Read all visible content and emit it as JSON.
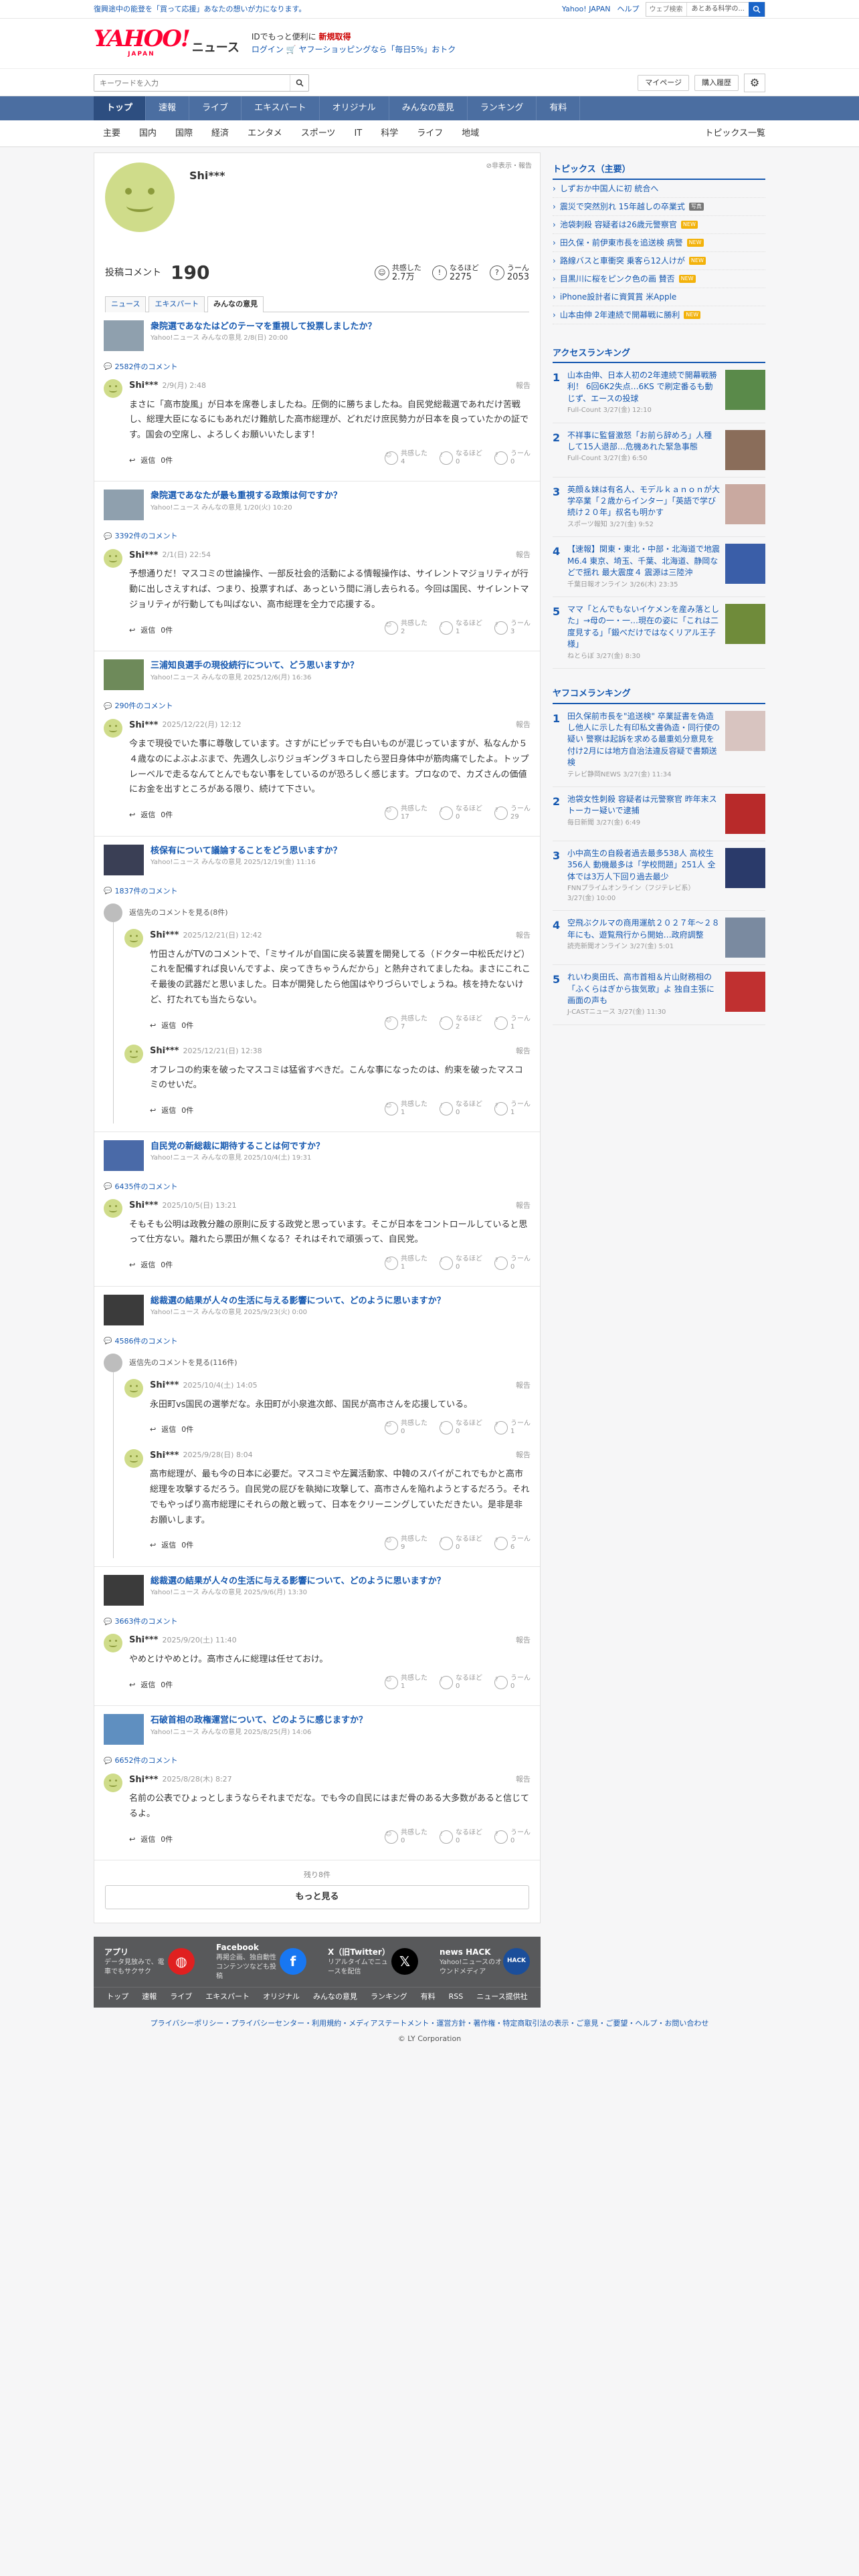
{
  "topbar": {
    "notice": "復興途中の能登を「買って応援」あなたの想いが力になります。",
    "links": [
      "Yahoo! JAPAN",
      "ヘルプ"
    ],
    "search_placeholder": "ウェブ検索",
    "search_scope": "あとある科学の..."
  },
  "header": {
    "logo": "YAHOO!",
    "logo_sub": "JAPAN",
    "section": "ニュース",
    "promo_line1_a": "ID",
    "promo_line1_b": "でもっと便利に",
    "promo_line1_c": "新規取得",
    "promo_line2_a": "ログイン",
    "promo_line2_b": "ヤフーショッピングなら「毎日5%」おトク"
  },
  "search": {
    "placeholder": "キーワードを入力",
    "mypage": "マイページ",
    "history": "購入履歴"
  },
  "gnav": [
    "トップ",
    "速報",
    "ライブ",
    "エキスパート",
    "オリジナル",
    "みんなの意見",
    "ランキング",
    "有料"
  ],
  "snav": [
    "主要",
    "国内",
    "国際",
    "経済",
    "エンタメ",
    "スポーツ",
    "IT",
    "科学",
    "ライフ",
    "地域"
  ],
  "snav_right": "トピックス一覧",
  "profile": {
    "name": "Shi***",
    "report": "非表示・報告",
    "posts_label": "投稿コメント",
    "posts": "190",
    "reactions": [
      {
        "label": "共感した",
        "value": "2.7万",
        "icon": "☺"
      },
      {
        "label": "なるほど",
        "value": "2275",
        "icon": "!"
      },
      {
        "label": "うーん",
        "value": "2053",
        "icon": "?"
      }
    ]
  },
  "tabs": [
    "ニュース",
    "エキスパート",
    "みんなの意見"
  ],
  "blocks": [
    {
      "title": "衆院選であなたはどのテーマを重視して投票しましたか？",
      "meta": "Yahoo!ニュース みんなの意見 2/8(日) 20:00",
      "count": "2582件のコメント",
      "comments": [
        {
          "name": "Shi***",
          "date": "2/9(月) 2:48",
          "text": "まさに「高市旋風」が日本を席巻しましたね。圧倒的に勝ちましたね。自民党総裁選であれだけ苦戦し、総理大臣になるにもあれだけ難航した高市総理が、どれだけ庶民勢力が日本を良っていたかの証です。国会の空席し、よろしくお願いいたします！",
          "r": [
            "4",
            "0",
            "0"
          ]
        }
      ]
    },
    {
      "title": "衆院選であなたが最も重視する政策は何ですか？",
      "meta": "Yahoo!ニュース みんなの意見 1/20(火) 10:20",
      "count": "3392件のコメント",
      "comments": [
        {
          "name": "Shi***",
          "date": "2/1(日) 22:54",
          "text": "予想通りだ！マスコミの世論操作、一部反社会的活動による情報操作は、サイレントマジョリティが行動に出しさえすれば、つまり、投票すれば、あっという間に消し去られる。今回は国民、サイレントマジョリティが行動しても叫ばない、高市総理を全力で応援する。",
          "r": [
            "2",
            "1",
            "3"
          ]
        }
      ]
    },
    {
      "title": "三浦知良選手の現役続行について、どう思いますか？",
      "meta": "Yahoo!ニュース みんなの意見 2025/12/6(月) 16:36",
      "count": "290件のコメント",
      "comments": [
        {
          "name": "Shi***",
          "date": "2025/12/22(月) 12:12",
          "text": "今まで現役でいた事に尊敬しています。さすがにピッチでも白いものが混じっていますが、私なんか５４歳なのによぶよぶまで、先週久しぶりジョギング３キロしたら翌日身体中が筋肉痛でしたよ。トップレーベルで走るなんてとんでもない事をしているのが恐ろしく感じます。プロなので、カズさんの価値にお金を出すところがある限り、続けて下さい。",
          "r": [
            "17",
            "0",
            "29"
          ]
        }
      ]
    },
    {
      "title": "核保有について議論することをどう思いますか？",
      "meta": "Yahoo!ニュース みんなの意見 2025/12/19(金) 11:16",
      "count": "1837件のコメント",
      "collapsed": "返信先のコメントを見る(8件)",
      "comments": [
        {
          "name": "Shi***",
          "date": "2025/12/21(日) 12:42",
          "text": "竹田さんがTVのコメントで、「ミサイルが自国に戻る装置を開発してる（ドクター中松氏だけど）これを配備すれば良いんですよ、戻ってきちゃうんだから」と熱弁されてましたね。まさにこれこそ最後の武器だと思いました。日本が開発したら他国はやりづらいでしょうね。核を持たないけど、打たれても当たらない。",
          "r": [
            "7",
            "2",
            "1"
          ]
        },
        {
          "name": "Shi***",
          "date": "2025/12/21(日) 12:38",
          "text": "オフレコの約束を破ったマスコミは猛省すべきだ。こんな事になったのは、約束を破ったマスコミのせいだ。",
          "r": [
            "1",
            "0",
            "1"
          ]
        }
      ]
    },
    {
      "title": "自民党の新総裁に期待することは何ですか？",
      "meta": "Yahoo!ニュース みんなの意見 2025/10/4(土) 19:31",
      "count": "6435件のコメント",
      "comments": [
        {
          "name": "Shi***",
          "date": "2025/10/5(日) 13:21",
          "text": "そもそも公明は政教分離の原則に反する政党と思っています。そこが日本をコントロールしていると思って仕方ない。離れたら票田が無くなる？それはそれで頑張って、自民党。",
          "r": [
            "1",
            "0",
            "0"
          ]
        }
      ]
    },
    {
      "title": "総裁選の結果が人々の生活に与える影響について、どのように思いますか？",
      "meta": "Yahoo!ニュース みんなの意見 2025/9/23(火) 0:00",
      "count": "4586件のコメント",
      "collapsed": "返信先のコメントを見る(116件)",
      "comments": [
        {
          "name": "Shi***",
          "date": "2025/10/4(土) 14:05",
          "text": "永田町vs国民の選挙だな。永田町が小泉進次郎、国民が高市さんを応援している。",
          "r": [
            "0",
            "0",
            "1"
          ]
        },
        {
          "name": "Shi***",
          "date": "2025/9/28(日) 8:04",
          "text": "高市総理が、最も今の日本に必要だ。マスコミや左翼活動家、中韓のスパイがこれでもかと高市総理を攻撃するだろう。自民党の屁びを執拗に攻撃して、高市さんを陥れようとするだろう。それでもやっぱり高市総理にそれらの敵と戦って、日本をクリーニングしていただきたい。是非是非お願いします。",
          "r": [
            "9",
            "0",
            "6"
          ]
        }
      ]
    },
    {
      "title": "総裁選の結果が人々の生活に与える影響について、どのように思いますか？",
      "meta": "Yahoo!ニュース みんなの意見 2025/9/6(月) 13:30",
      "count": "3663件のコメント",
      "comments": [
        {
          "name": "Shi***",
          "date": "2025/9/20(土) 11:40",
          "text": "やめとけやめとけ。高市さんに総理は任せておけ。",
          "r": [
            "1",
            "0",
            "0"
          ]
        }
      ]
    },
    {
      "title": "石破首相の政権運営について、どのように感じますか？",
      "meta": "Yahoo!ニュース みんなの意見 2025/8/25(月) 14:06",
      "count": "6652件のコメント",
      "comments": [
        {
          "name": "Shi***",
          "date": "2025/8/28(木) 8:27",
          "text": "名前の公表でひょっとしまうならそれまでだな。でも今の自民にはまだ骨のある大多数があると信じてるよ。",
          "r": [
            "0",
            "0",
            "0"
          ]
        }
      ]
    }
  ],
  "reply_label": "返信",
  "reply_count": "0件",
  "report_label": "報告",
  "react_labels": [
    "共感した",
    "なるほど",
    "うーん"
  ],
  "more": {
    "remaining": "残り8件",
    "button": "もっと見る"
  },
  "sidebar": {
    "topics_title": "トピックス（主要）",
    "topics": [
      {
        "t": "しずおか中国人に初 統合へ",
        "b": ""
      },
      {
        "t": "震災で突然別れ 15年越しの卒業式",
        "b": "写真"
      },
      {
        "t": "池袋刺殺 容疑者は26歳元警察官",
        "b": "NEW"
      },
      {
        "t": "田久保・前伊東市長を追送検 病警",
        "b": "NEW"
      },
      {
        "t": "路線バスと車衝突 乗客ら12人けが",
        "b": "NEW"
      },
      {
        "t": "目黒川に桜をピンク色の画 賛否",
        "b": "NEW"
      },
      {
        "t": "iPhone設計者に資質賞 米Apple",
        "b": ""
      },
      {
        "t": "山本由伸 2年連続で開幕戦に勝利",
        "b": "NEW"
      }
    ],
    "access_title": "アクセスランキング",
    "access": [
      {
        "t": "山本由伸、日本人初の2年連続で開幕戦勝利！ 6回6K2失点…6KS で刷定番るも動じず、エースの投球",
        "m": "Full-Count 3/27(金) 12:10",
        "c": "#5a8a4a"
      },
      {
        "t": "不祥事に監督激怒「お前ら辞めろ」人種して15人退部…危機あれた緊急事態",
        "m": "Full-Count 3/27(金) 6:50",
        "c": "#8a6d5a"
      },
      {
        "t": "英顔＆妹は有名人、モデルｋａｎｏｎが大学卒業「２歳からインター」「英語で学び続け２０年」叔名も明かす",
        "m": "スポーツ報知 3/27(金) 9:52",
        "c": "#c9a9a0"
      },
      {
        "t": "【速報】関東・東北・中部・北海道で地震 M6.4 東京、埼玉、千葉、北海道、静岡などで揺れ 最大震度４ 震源は三陸沖",
        "m": "千葉日報オンライン 3/26(木) 23:35",
        "c": "#3a5ea8"
      },
      {
        "t": "ママ「とんでもないイケメンを産み落とした」→母の一・一…現在の姿に「これは二度見する」「鍛べだけではなくリアル王子様」",
        "m": "ねとらぼ 3/27(金) 8:30",
        "c": "#6f8b3a"
      }
    ],
    "comment_title": "ヤフコメランキング",
    "comments": [
      {
        "t": "田久保前市長を\"追送検\" 卒業証書を偽造し他人に示した有印私文書偽造・同行使の疑い 警察は起訴を求める最重処分意見を付け2月には地方自治法違反容疑で書類送検",
        "m": "テレビ静岡NEWS 3/27(金) 11:34",
        "c": "#d8c4c0"
      },
      {
        "t": "池袋女性刺殺 容疑者は元警察官 昨年末ストーカー疑いで逮捕",
        "m": "毎日新聞 3/27(金) 6:49",
        "c": "#b82a2a"
      },
      {
        "t": "小中高生の自殺者過去最多538人 高校生356人 動機最多は「学校問題」251人 全体では3万人下回り過去最少",
        "m": "FNNプライムオンライン（フジテレビ系） 3/27(金) 10:00",
        "c": "#2a3a6a"
      },
      {
        "t": "空飛ぶクルマの商用運航２０２７年～２８年にも、遊覧飛行から開始…政府調整",
        "m": "読売新聞オンライン 3/27(金) 5:01",
        "c": "#7a8aa0"
      },
      {
        "t": "れいわ奥田氏、高市首相＆片山財務相の「ふくらはぎから抜気歌」よ 独自主張に画面の声も",
        "m": "J-CASTニュース 3/27(金) 11:30",
        "c": "#c03030"
      }
    ]
  },
  "footer": {
    "boxes": [
      {
        "title": "アプリ",
        "desc": "データ見放みで、電車でもサクサク",
        "icon": "app-icon",
        "bg": "#e02020",
        "glyph": "◍"
      },
      {
        "title": "Facebook",
        "desc": "再掲企画、独自動性コンテンツなども投稿",
        "icon": "facebook-icon",
        "bg": "#1877f2",
        "glyph": "f"
      },
      {
        "title": "X（旧Twitter）",
        "desc": "リアルタイムでニュースを配信",
        "icon": "x-icon",
        "bg": "#000000",
        "glyph": "𝕏"
      },
      {
        "title": "news HACK",
        "desc": "Yahoo!ニュースのオウンドメディア",
        "icon": "newshack-icon",
        "bg": "#1b4e9a",
        "glyph": "HACK"
      }
    ],
    "links": [
      "トップ",
      "速報",
      "ライブ",
      "エキスパート",
      "オリジナル",
      "みんなの意見",
      "ランキング",
      "有料",
      "RSS",
      "ニュース提供社"
    ],
    "legal": "プライバシーポリシー・プライバシーセンター・利用規約・メディアステートメント・運営方針・著作権・特定商取引法の表示・ご意見・ご要望・ヘルプ・お問い合わせ",
    "copyright": "© LY Corporation"
  }
}
